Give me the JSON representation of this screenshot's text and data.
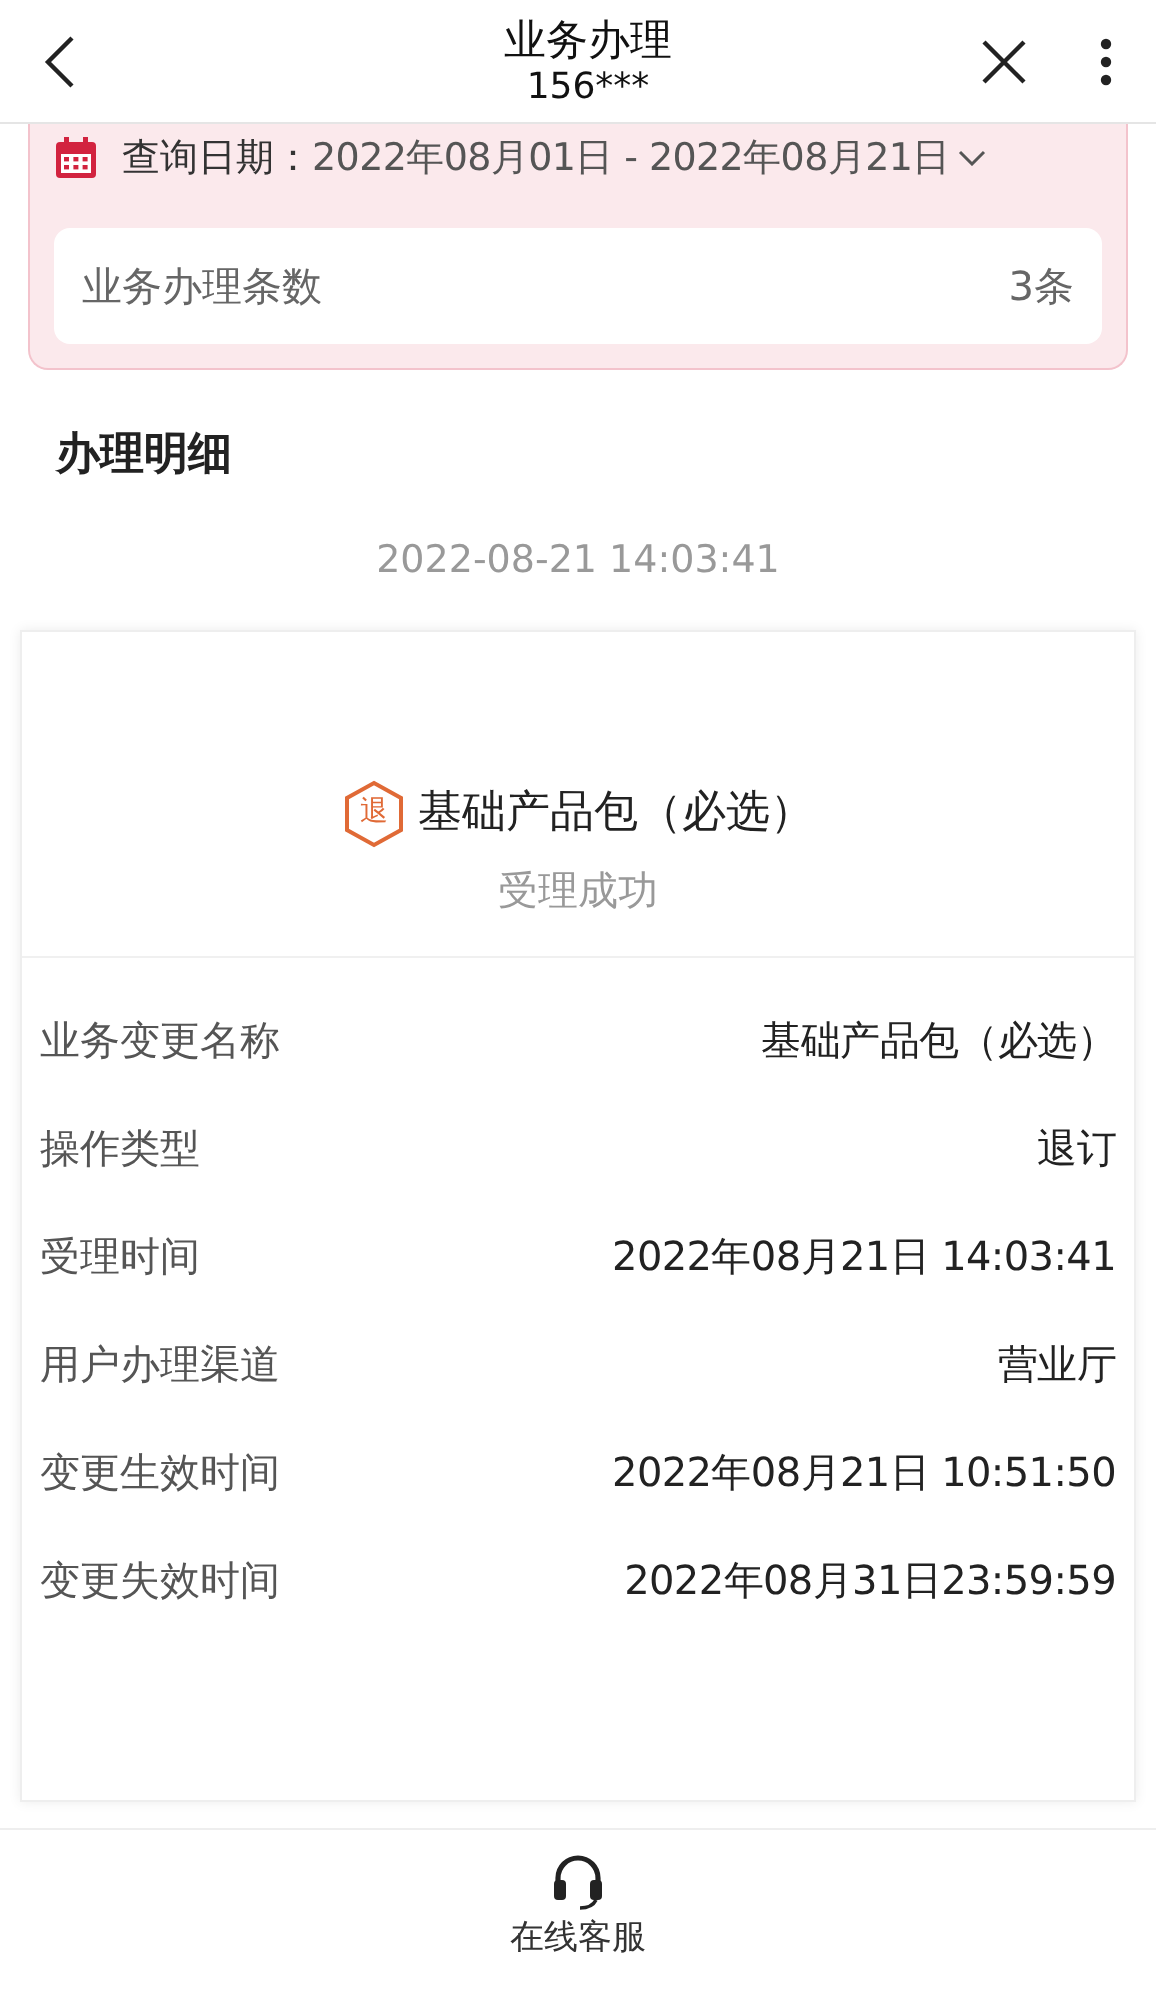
{
  "header": {
    "title": "业务办理",
    "subtitle": "156***"
  },
  "query": {
    "label": "查询日期：",
    "date_range": "2022年08月01日 - 2022年08月21日",
    "count_label": "业务办理条数",
    "count_value": "3条"
  },
  "section_title": "办理明细",
  "records": [
    {
      "timestamp": "2022-08-21 14:03:41",
      "badge": "退",
      "product": "基础产品包（必选）",
      "status": "受理成功",
      "fields": [
        {
          "label": "业务变更名称",
          "value": "基础产品包（必选）"
        },
        {
          "label": "操作类型",
          "value": "退订"
        },
        {
          "label": "受理时间",
          "value": "2022年08月21日 14:03:41"
        },
        {
          "label": "用户办理渠道",
          "value": "营业厅"
        },
        {
          "label": "变更生效时间",
          "value": "2022年08月21日 10:51:50"
        },
        {
          "label": "变更失效时间",
          "value": "2022年08月31日23:59:59"
        }
      ]
    }
  ],
  "footer": {
    "service_label": "在线客服"
  }
}
